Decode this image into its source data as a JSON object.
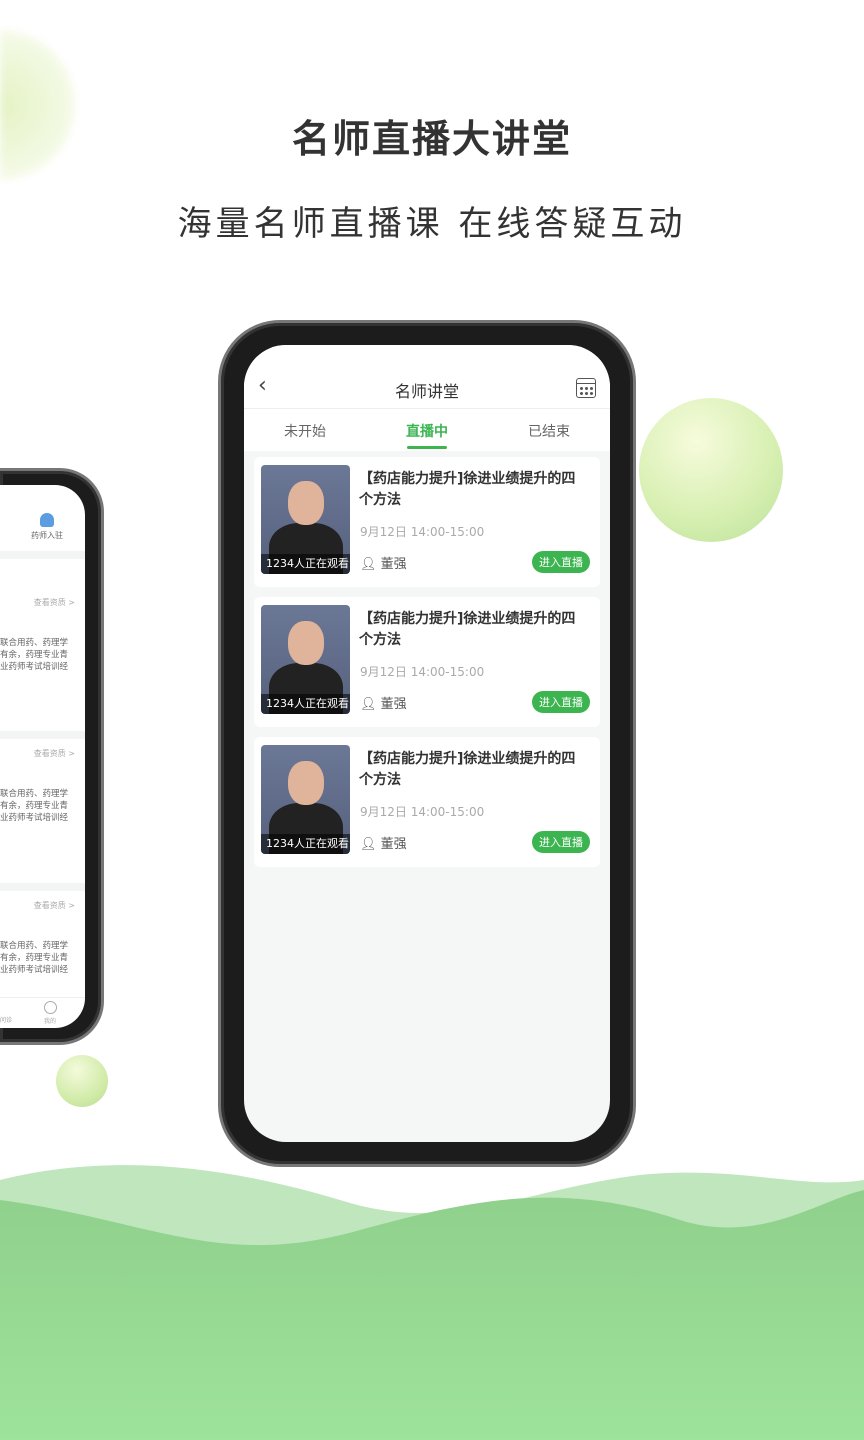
{
  "headline": "名师直播大讲堂",
  "subheadline": "海量名师直播课 在线答疑互动",
  "colors": {
    "accent": "#3cb551",
    "wave": "#8fd68f"
  },
  "app": {
    "title": "名师讲堂",
    "back_icon": "chevron-left-icon",
    "calendar_icon": "calendar-icon",
    "tabs": [
      {
        "label": "未开始",
        "active": false
      },
      {
        "label": "直播中",
        "active": true
      },
      {
        "label": "已结束",
        "active": false
      }
    ],
    "courses": [
      {
        "viewers": "1234人正在观看",
        "title": "【药店能力提升]徐进业绩提升的四个方法",
        "time": "9月12日  14:00-15:00",
        "teacher": "董强",
        "button": "进入直播"
      },
      {
        "viewers": "1234人正在观看",
        "title": "【药店能力提升]徐进业绩提升的四个方法",
        "time": "9月12日  14:00-15:00",
        "teacher": "董强",
        "button": "进入直播"
      },
      {
        "viewers": "1234人正在观看",
        "title": "【药店能力提升]徐进业绩提升的四个方法",
        "time": "9月12日  14:00-15:00",
        "teacher": "董强",
        "button": "进入直播"
      }
    ]
  },
  "left_phone": {
    "join_label": "药师入驻",
    "items": [
      {
        "link": "查看资质 >",
        "lines": [
          "联合用药、药理学",
          "有余，药理专业青",
          "业药师考试培训经"
        ]
      },
      {
        "link": "查看资质 >",
        "lines": [
          "联合用药、药理学",
          "有余，药理专业青",
          "业药师考试培训经"
        ]
      },
      {
        "link": "查看资质 >",
        "lines": [
          "联合用药、药理学",
          "有余，药理专业青",
          "业药师考试培训经"
        ]
      }
    ],
    "tab_consult": "问诊",
    "tab_mine": "我的"
  }
}
